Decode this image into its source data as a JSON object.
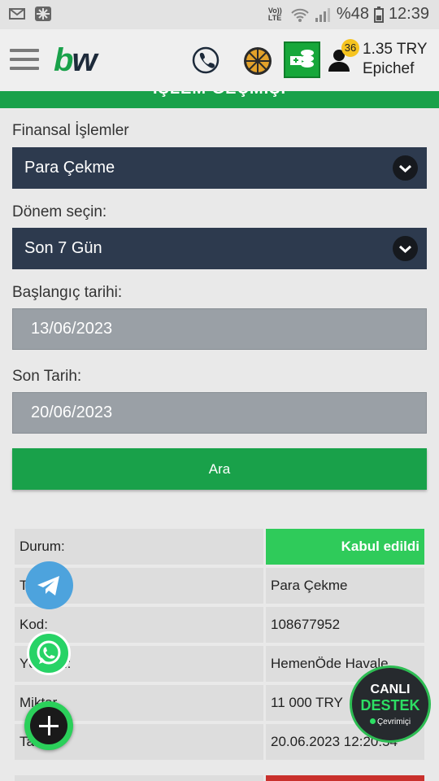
{
  "status": {
    "battery": "%48",
    "time": "12:39",
    "network": "Vo)) LTE"
  },
  "header": {
    "logo_b": "b",
    "logo_w": "w",
    "notification_count": "36",
    "balance": "1.35 TRY",
    "username": "Epichef"
  },
  "page": {
    "title": "İŞLEM GEÇMİŞİ"
  },
  "form": {
    "finance_label": "Finansal İşlemler",
    "finance_value": "Para Çekme",
    "period_label": "Dönem seçin:",
    "period_value": "Son 7 Gün",
    "start_label": "Başlangıç tarihi:",
    "start_value": "13/06/2023",
    "end_label": "Son Tarih:",
    "end_value": "20/06/2023",
    "search_button": "Ara"
  },
  "transaction": {
    "rows": [
      {
        "key": "Durum:",
        "value": "Kabul edildi"
      },
      {
        "key": "Tür:",
        "value": "Para Çekme"
      },
      {
        "key": "Kod:",
        "value": "108677952"
      },
      {
        "key": "Yöntem:",
        "value": "HemenÖde Havale"
      },
      {
        "key": "Miktar",
        "value": "11 000 TRY"
      },
      {
        "key": "Tarih",
        "value": "20.06.2023 12:20:54"
      }
    ]
  },
  "support": {
    "line1": "CANLI",
    "line2": "DESTEK",
    "line3": "Çevrimiçi"
  },
  "colors": {
    "brand_green": "#19a14a",
    "dark_select": "#2d3a4e",
    "accepted": "#2fcb5a"
  }
}
